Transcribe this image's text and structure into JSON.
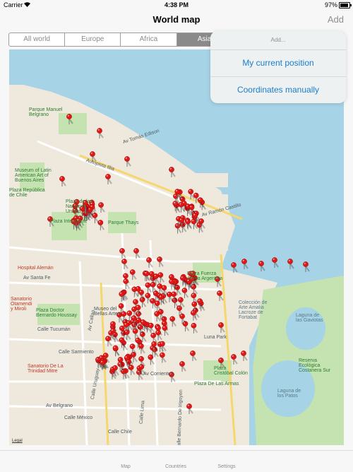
{
  "status_bar": {
    "carrier": "Carrier",
    "time": "4:38 PM",
    "battery": "97%"
  },
  "nav": {
    "title": "World map",
    "add_label": "Add"
  },
  "segments": {
    "selected_index": 3,
    "items": [
      "All world",
      "Europe",
      "Africa",
      "Asia",
      "",
      ""
    ]
  },
  "popover": {
    "title": "Add...",
    "items": [
      "My current position",
      "Coordinates manually"
    ]
  },
  "map": {
    "legal": "Legal",
    "labels": {
      "parque_manuel_belgrano": "Parque Manuel\nBelgrano",
      "museum_latin": "Museum of Latin\nAmerican Art of\nBuenos Aires",
      "plaza_republica_chile": "Plaza República\nde Chile",
      "plaza_naciones": "Plaza de las\nNaciones\nUnidas",
      "plaza_intendente": "Plaza Intendente",
      "parque_thays": "Parque Thays",
      "plaza_fuerza_aerea": "Plaza Fuerza\nAérea Argentina",
      "hospital_aleman": "Hospital Alemán",
      "sanatorio_otamendi": "Sanatorio\nOtamendi\ny Miroli",
      "plaza_doctor": "Plaza Doctor\nBernardo Houssay",
      "museo_bellas": "Museo del\nBellas Artes",
      "luna_park": "Luna Park",
      "plaza_cristobal_colon": "Plaza\nCristóbal Colón",
      "coleccion_fortabat": "Colección de\nArte Amalia\nLacroze de\nFortabat",
      "laguna_gaviotas": "Laguna de\nlas Gaviotas",
      "reserva_ecologica": "Reserva\nEcológica\nCostanera Sur",
      "laguna_patos": "Laguna de\nlos Patos",
      "sanatorio_trinidad": "Sanatorio De La\nTrinidad Mitre",
      "plaza_armas": "Plaza De Las Armas",
      "av_belgrano": "Av Belgrano",
      "calle_mexico": "Calle México",
      "calle_chile": "Calle Chile",
      "calle_tucuman": "Calle Tucumán",
      "calle_sarmiento": "Calle Sarmiento",
      "av_santa_fe": "Av Santa Fe",
      "av_corrientes": "Av Corrientes",
      "autopista_illia": "Autopista Illia",
      "av_ramon_castillo": "Av Ramón Castillo",
      "av_tomas_edison": "Av Tomás Edison",
      "av_callao": "Av Callao",
      "calle_uruguay": "Calle Uruguay",
      "calle_lima": "Calle Lima",
      "calle_bernardo": "Calle Bernardo De Irigoyen"
    }
  },
  "tabs": [
    "Map",
    "Countries",
    "Settings"
  ],
  "colors": {
    "water": "#a6d3e6",
    "park": "#c4e3b0",
    "land": "#efe8dc",
    "pin": "#e01818",
    "link": "#1a7dcc"
  }
}
